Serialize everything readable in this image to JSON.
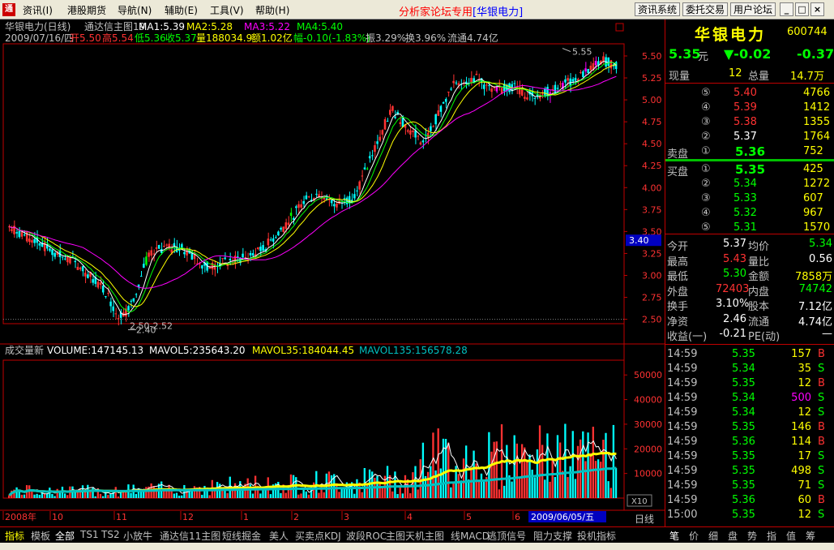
{
  "menu": {
    "items": [
      "资讯(I)",
      "港股期货",
      "导航(N)",
      "辅助(E)",
      "工具(V)",
      "帮助(H)"
    ],
    "title": "分析家论坛专用",
    "title_stock": "[华银电力]",
    "right_buttons": [
      "资讯系统",
      "委托交易",
      "用户论坛"
    ]
  },
  "header": {
    "line1": [
      "华银电力(日线)",
      "通达信主图19",
      "MA1:5.39",
      "MA2:5.28",
      "MA3:5.22",
      "MA4:5.40"
    ],
    "line2": {
      "date": "2009/07/16/四",
      "open": "开5.50",
      "high": "高5.54",
      "low": "低5.36",
      "close": "收5.37",
      "volume": "量188034.9",
      "amount": "额1.02亿",
      "change": "幅-0.10(-1.83%)",
      "amplitude": "振3.29%",
      "turnover": "换3.96%",
      "float": "流通4.74亿"
    }
  },
  "chart_data": [
    {
      "type": "candlestick",
      "title": "华银电力(日线)",
      "y_ticks": [
        "5.50",
        "5.25",
        "5.00",
        "4.75",
        "4.50",
        "4.25",
        "4.00",
        "3.75",
        "3.50",
        "3.25",
        "3.00",
        "2.75",
        "2.50"
      ],
      "ylim": [
        2.45,
        5.62
      ],
      "x_labels": [
        "2008年",
        "10",
        "11",
        "12",
        "1",
        "2",
        "3",
        "4",
        "5",
        "6"
      ],
      "series": [
        {
          "name": "MA1:5.39",
          "color": "#ffffff"
        },
        {
          "name": "MA2:5.28",
          "color": "#ffff00"
        },
        {
          "name": "MA3:5.22",
          "color": "#ff00ff"
        },
        {
          "name": "MA4:5.40",
          "color": "#00ff00"
        }
      ],
      "annotations": [
        {
          "text": "5.55",
          "value": 5.55
        },
        {
          "text": "2.50-2.52",
          "value": 2.52
        },
        {
          "text": "2.40",
          "value": 2.4
        }
      ],
      "current_price_label": "3.40",
      "current_price_value": 3.4
    },
    {
      "type": "bar",
      "title": "成交量新",
      "legend": [
        "VOLUME:147145.13",
        "MAVOL5:235643.20",
        "MAVOL35:184044.45",
        "MAVOL135:156578.28"
      ],
      "y_ticks": [
        "50000",
        "40000",
        "30000",
        "20000",
        "10000"
      ],
      "ylim": [
        0,
        56000
      ],
      "unit_label": "X10"
    }
  ],
  "cursor_date": "2009/06/05/五",
  "period": "日线",
  "panel": {
    "stock_name": "华银电力",
    "stock_code": "600744",
    "price": "5.35",
    "price_unit": "元",
    "change": "▼-0.02",
    "change2": "-0.37",
    "current_volume_label": "现量",
    "current_volume": "12",
    "total_volume_label": "总量",
    "total_volume": "14.7万",
    "sell_label": "卖盘",
    "buy_label": "买盘",
    "asks": [
      {
        "level": "⑤",
        "price": "5.40",
        "vol": "4766"
      },
      {
        "level": "④",
        "price": "5.39",
        "vol": "1412"
      },
      {
        "level": "③",
        "price": "5.38",
        "vol": "1355"
      },
      {
        "level": "②",
        "price": "5.37",
        "vol": "1764"
      },
      {
        "level": "①",
        "price": "5.36",
        "vol": "752"
      }
    ],
    "bids": [
      {
        "level": "①",
        "price": "5.35",
        "vol": "425"
      },
      {
        "level": "②",
        "price": "5.34",
        "vol": "1272"
      },
      {
        "level": "③",
        "price": "5.33",
        "vol": "607"
      },
      {
        "level": "④",
        "price": "5.32",
        "vol": "967"
      },
      {
        "level": "⑤",
        "price": "5.31",
        "vol": "1570"
      }
    ],
    "stats": [
      {
        "l1": "今开",
        "v1": "5.37",
        "l2": "均价",
        "v2": "5.34"
      },
      {
        "l1": "最高",
        "v1": "5.43",
        "l2": "量比",
        "v2": "0.56"
      },
      {
        "l1": "最低",
        "v1": "5.30",
        "l2": "金额",
        "v2": "7858万"
      },
      {
        "l1": "外盘",
        "v1": "72403",
        "l2": "内盘",
        "v2": "74742"
      },
      {
        "l1": "换手",
        "v1": "3.10%",
        "l2": "股本",
        "v2": "7.12亿"
      },
      {
        "l1": "净资",
        "v1": "2.46",
        "l2": "流通",
        "v2": "4.74亿"
      },
      {
        "l1": "收益(一)",
        "v1": "-0.21",
        "l2": "PE(动)",
        "v2": "—"
      }
    ],
    "ticks": [
      {
        "time": "14:59",
        "price": "5.35",
        "vol": "157",
        "side": "B"
      },
      {
        "time": "14:59",
        "price": "5.34",
        "vol": "35",
        "side": "S"
      },
      {
        "time": "14:59",
        "price": "5.35",
        "vol": "12",
        "side": "B"
      },
      {
        "time": "14:59",
        "price": "5.34",
        "vol": "500",
        "side": "S"
      },
      {
        "time": "14:59",
        "price": "5.34",
        "vol": "12",
        "side": "S"
      },
      {
        "time": "14:59",
        "price": "5.35",
        "vol": "146",
        "side": "B"
      },
      {
        "time": "14:59",
        "price": "5.36",
        "vol": "114",
        "side": "B"
      },
      {
        "time": "14:59",
        "price": "5.35",
        "vol": "17",
        "side": "S"
      },
      {
        "time": "14:59",
        "price": "5.35",
        "vol": "498",
        "side": "S"
      },
      {
        "time": "14:59",
        "price": "5.35",
        "vol": "71",
        "side": "S"
      },
      {
        "time": "14:59",
        "price": "5.36",
        "vol": "60",
        "side": "B"
      },
      {
        "time": "15:00",
        "price": "5.35",
        "vol": "12",
        "side": "S"
      }
    ]
  },
  "bottom_tabs": [
    "指标",
    "模板",
    "全部",
    "TS1",
    "TS2",
    "小放牛",
    "通达信11主图",
    "短线掘金",
    "美人",
    "买卖点KDJ",
    "波段ROC",
    "主图天机主图",
    "线MACD",
    "逃顶信号",
    "阻力支撑",
    "投机指标"
  ],
  "right_tabs": [
    "笔",
    "价",
    "细",
    "盘",
    "势",
    "指",
    "值",
    "筹"
  ],
  "colors": {
    "up": "#ff3232",
    "down": "#00ffff",
    "grid": "#c00000",
    "ma1": "#ffffff",
    "ma2": "#ffff00",
    "ma3": "#ff00ff",
    "ma4": "#00ff00",
    "mavol5": "#ffffff",
    "mavol35": "#ffff00",
    "mavol135": "#00c0c0"
  }
}
